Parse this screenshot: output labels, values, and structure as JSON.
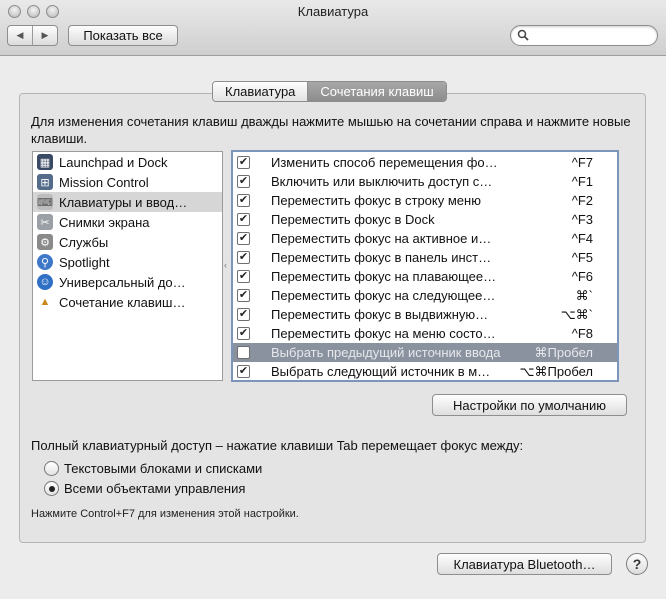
{
  "window": {
    "title": "Клавиатура"
  },
  "toolbar": {
    "back_glyph": "◀",
    "forward_glyph": "▶",
    "show_all": "Показать все",
    "search_placeholder": ""
  },
  "tabs": [
    {
      "label": "Клавиатура"
    },
    {
      "label": "Сочетания клавиш"
    }
  ],
  "hint": "Для изменения сочетания клавиш дважды нажмите мышью на сочетании справа и нажмите новые клавиши.",
  "categories": [
    {
      "label": "Launchpad и Dock",
      "icon": "launchpad-dock-icon"
    },
    {
      "label": "Mission Control",
      "icon": "mission-control-icon"
    },
    {
      "label": "Клавиатуры и ввод…",
      "icon": "keyboard-input-icon"
    },
    {
      "label": "Снимки экрана",
      "icon": "screenshot-icon"
    },
    {
      "label": "Службы",
      "icon": "services-gear-icon"
    },
    {
      "label": "Spotlight",
      "icon": "spotlight-icon"
    },
    {
      "label": "Универсальный до…",
      "icon": "accessibility-icon"
    },
    {
      "label": "Сочетание клавиш…",
      "icon": "app-shortcuts-icon"
    }
  ],
  "shortcuts": [
    {
      "title": "Изменить способ перемещения фо…",
      "key": "^F7",
      "checked": true
    },
    {
      "title": "Включить или выключить доступ с…",
      "key": "^F1",
      "checked": true
    },
    {
      "title": "Переместить фокус в строку меню",
      "key": "^F2",
      "checked": true
    },
    {
      "title": "Переместить фокус в Dock",
      "key": "^F3",
      "checked": true
    },
    {
      "title": "Переместить фокус на активное и…",
      "key": "^F4",
      "checked": true
    },
    {
      "title": "Переместить фокус в панель инст…",
      "key": "^F5",
      "checked": true
    },
    {
      "title": "Переместить фокус на плавающее…",
      "key": "^F6",
      "checked": true
    },
    {
      "title": "Переместить фокус на следующее…",
      "key": "⌘`",
      "checked": true
    },
    {
      "title": "Переместить фокус в выдвижную…",
      "key": "⌥⌘`",
      "checked": true
    },
    {
      "title": "Переместить фокус на меню состо…",
      "key": "^F8",
      "checked": true
    },
    {
      "title": "Выбрать предыдущий источник ввода",
      "key": "⌘Пробел",
      "checked": false
    },
    {
      "title": "Выбрать следующий источник в м…",
      "key": "⌥⌘Пробел",
      "checked": true
    }
  ],
  "defaults_button": "Настройки по умолчанию",
  "full_access": {
    "label": "Полный клавиатурный доступ – нажатие клавиши Tab перемещает фокус между:",
    "options": [
      {
        "label": "Текстовыми блоками и списками",
        "selected": false
      },
      {
        "label": "Всеми объектами управления",
        "selected": true
      }
    ],
    "note": "Нажмите Control+F7 для изменения этой настройки."
  },
  "bluetooth_button": "Клавиатура Bluetooth…",
  "help_glyph": "?",
  "checkmark_glyph": "✔"
}
